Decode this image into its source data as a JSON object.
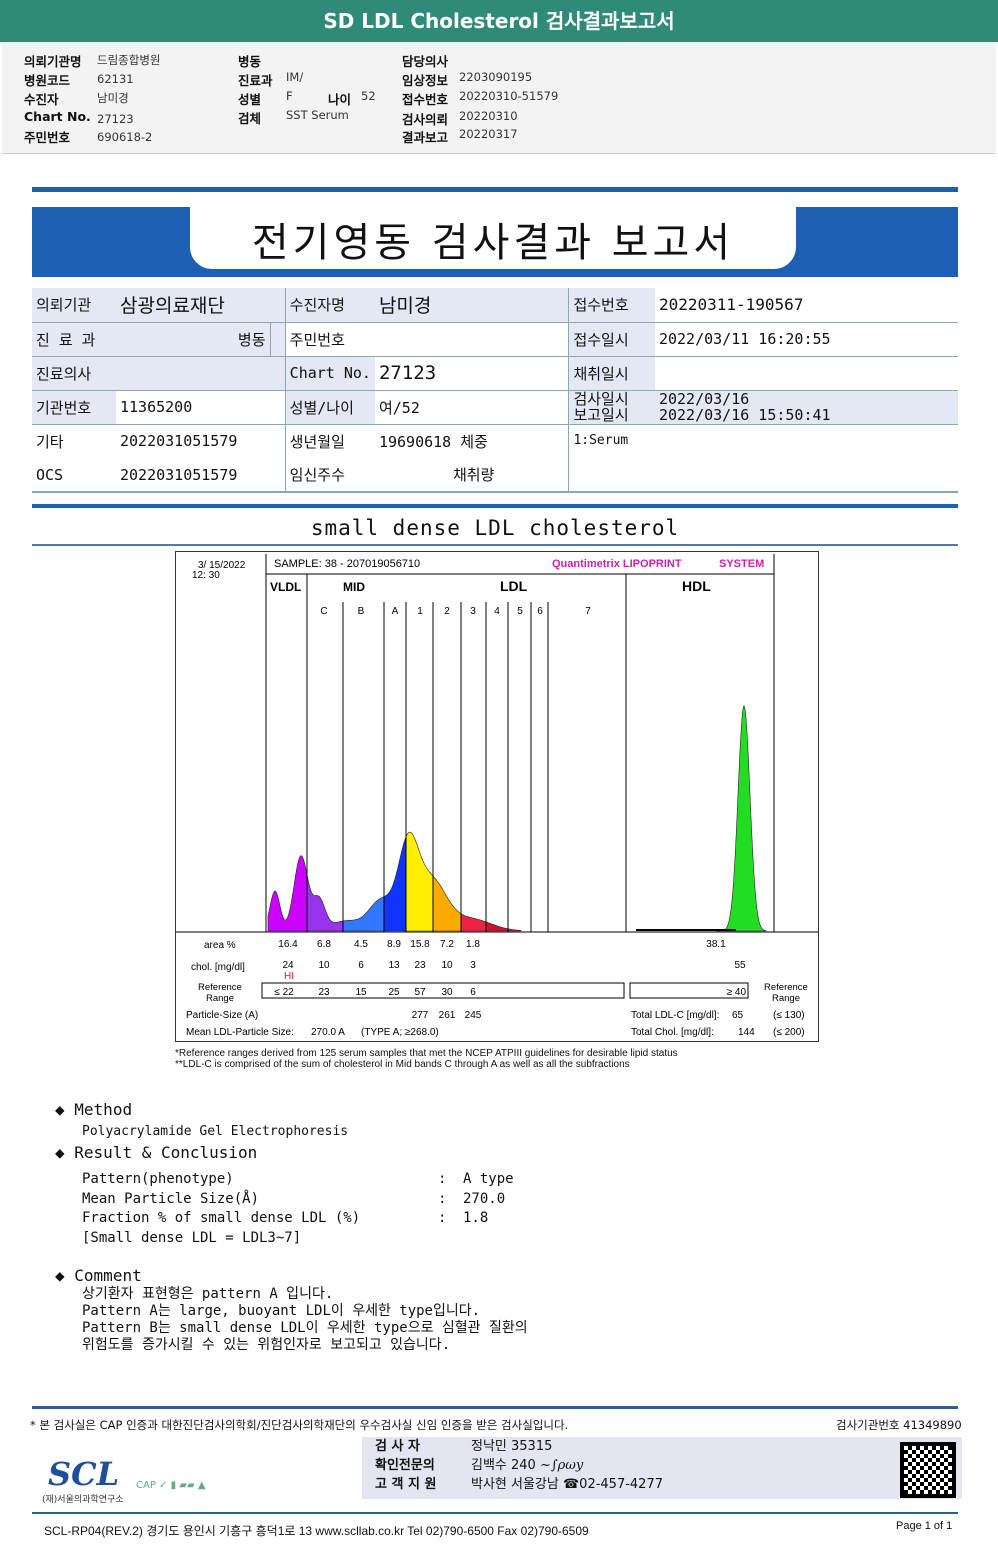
{
  "title": "SD LDL Cholesterol 검사결과보고서",
  "header": {
    "col1": [
      {
        "label": "의뢰기관명",
        "value": "드림종합병원"
      },
      {
        "label": "병원코드",
        "value": "62131"
      },
      {
        "label": "수진자",
        "value": "남미경"
      },
      {
        "label": "Chart No.",
        "value": "27123"
      },
      {
        "label": "주민번호",
        "value": "690618-2"
      }
    ],
    "col2": [
      {
        "label": "병동",
        "value": ""
      },
      {
        "label": "진료과",
        "value": "IM/"
      },
      {
        "label": "성별",
        "value": "F"
      },
      {
        "label": "검체",
        "value": "SST Serum"
      }
    ],
    "age_label": "나이",
    "age_value": "52",
    "col3": [
      {
        "label": "담당의사",
        "value": ""
      },
      {
        "label": "임상정보",
        "value": "2203090195"
      },
      {
        "label": "접수번호",
        "value": "20220310-51579"
      },
      {
        "label": "검사의뢰",
        "value": "20220310"
      },
      {
        "label": "결과보고",
        "value": "20220317"
      }
    ]
  },
  "report_title": "전기영동 검사결과 보고서",
  "info": {
    "r1": [
      "의뢰기관",
      "삼광의료재단",
      "수진자명",
      "남미경",
      "접수번호",
      "20220311-190567"
    ],
    "r2": [
      "진 료 과",
      "병동",
      "주민번호",
      "",
      "접수일시",
      "2022/03/11 16:20:55"
    ],
    "r3": [
      "진료의사",
      "",
      "Chart No.",
      "27123",
      "채취일시",
      ""
    ],
    "r4": [
      "기관번호",
      "11365200",
      "성별/나이",
      "여/52",
      "검사일시",
      "2022/03/16"
    ],
    "r4b": [
      "보고일시",
      "2022/03/16 15:50:41"
    ],
    "r5": [
      "기타",
      "2022031051579",
      "생년월일",
      "19690618 체중",
      "1:Serum"
    ],
    "r6": [
      "OCS",
      "2022031051579",
      "임신주수",
      "채취량"
    ]
  },
  "section_title": "small dense LDL cholesterol",
  "chart_data": {
    "type": "area",
    "date": "3/ 15/2022",
    "time": "12: 30",
    "sample": "SAMPLE:   38 - 207019056710",
    "brand": "Quantimetrix LIPOPRINT",
    "brand_suffix": "SYSTEM",
    "groups": [
      "VLDL",
      "MID",
      "LDL",
      "HDL"
    ],
    "bands": [
      "C",
      "B",
      "A",
      "1",
      "2",
      "3",
      "4",
      "5",
      "6",
      "7"
    ],
    "row_labels": {
      "area": "area %",
      "chol": "chol. [mg/dl]",
      "ref": "Reference Range",
      "ref_right": "Reference Range"
    },
    "area": [
      "16.4",
      "6.8",
      "4.5",
      "8.9",
      "15.8",
      "7.2",
      "1.8"
    ],
    "chol": [
      "24",
      "10",
      "6",
      "13",
      "23",
      "10",
      "3"
    ],
    "hi_flag": "HI",
    "ref": [
      "≤ 22",
      "23",
      "15",
      "25",
      "57",
      "30",
      "6"
    ],
    "hdl": {
      "area": "38.1",
      "chol": "55",
      "ref": "≥  40"
    },
    "particle_label": "Particle-Size (A)",
    "particle": [
      "277",
      "261",
      "245"
    ],
    "mean_label": "Mean LDL-Particle Size:",
    "mean_value": "270.0  A",
    "mean_type": "(TYPE A; ≥268.0)",
    "total_ldl": {
      "label": "Total LDL-C [mg/dl]:",
      "value": "65",
      "ref": "(≤ 130)"
    },
    "total_chol": {
      "label": "Total Chol. [mg/dl]:",
      "value": "144",
      "ref": "(≤ 200)"
    },
    "colors": {
      "VLDL": "#cc00ff",
      "C": "#9933ee",
      "B": "#3377ff",
      "A": "#1133ff",
      "1": "#ffee00",
      "2": "#ffaa00",
      "3": "#ee2244",
      "4": "#cc1133",
      "HDL": "#22dd22"
    }
  },
  "footnotes": [
    "*Reference ranges derived from 125 serum samples that met the NCEP ATPIII guidelines for desirable lipid status",
    "**LDL-C is comprised of the sum of cholesterol in Mid bands C through A as well as all the subfractions"
  ],
  "method": {
    "title": "Method",
    "text": "Polyacrylamide Gel Electrophoresis"
  },
  "result": {
    "title": "Result & Conclusion",
    "rows": [
      {
        "k": "Pattern(phenotype)",
        "v": "A type"
      },
      {
        "k": "Mean Particle Size(Å)",
        "v": "270.0"
      },
      {
        "k": "Fraction % of small dense LDL (%)",
        "v": "1.8"
      }
    ],
    "note": "[Small dense LDL = LDL3~7]"
  },
  "comment": {
    "title": "Comment",
    "lines": [
      "상기환자 표현형은 pattern A 입니다.",
      "Pattern A는 large, buoyant LDL이 우세한 type입니다.",
      "Pattern B는 small dense LDL이 우세한 type으로 심혈관 질환의",
      "위험도를 증가시킬 수 있는 위험인자로 보고되고 있습니다."
    ]
  },
  "footer": {
    "cert": "* 본 검사실은 CAP 인증과 대한진단검사의학회/진단검사의학재단의 우수검사실 신임 인증을 받은 검사실입니다.",
    "inst_no": "검사기관번호 41349890",
    "signers": [
      {
        "role": "검  사  자",
        "value": "정낙민 35315"
      },
      {
        "role": "확인전문의",
        "value": "김백수 240"
      },
      {
        "role": "고 객 지 원",
        "value": "박사현 서울강남 ☎02-457-4277"
      }
    ],
    "logo": "SCL",
    "logo_sub": "(재)서울의과학연구소",
    "address": "SCL-RP04(REV.2)  경기도 용인시 기흥구 흥덕1로 13  www.scllab.co.kr   Tel 02)790-6500   Fax 02)790-6509",
    "page": "Page 1 of 1"
  }
}
